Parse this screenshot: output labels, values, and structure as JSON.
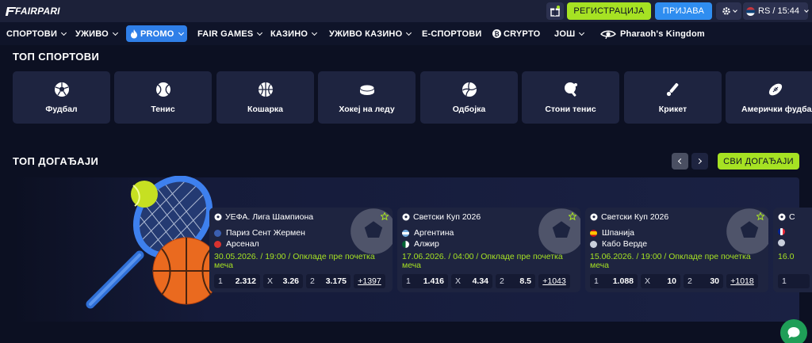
{
  "header": {
    "logo_text": "FAIRPARI",
    "register_label": "РЕГИСТРАЦИЈА",
    "login_label": "ПРИЈАВА",
    "locale_label": "RS / 15:44",
    "colors": {
      "accent_green": "#a6e223",
      "accent_blue": "#2f8df0"
    }
  },
  "nav": {
    "items": [
      {
        "label": "СПОРТОВИ",
        "dropdown": true
      },
      {
        "label": "УЖИВО",
        "dropdown": true
      },
      {
        "label": "PROMO",
        "dropdown": true,
        "active": true,
        "icon": "flame-icon"
      },
      {
        "label": "FAIR GAMES",
        "dropdown": true
      },
      {
        "label": "КАЗИНО",
        "dropdown": true
      },
      {
        "label": "УЖИВО КАЗИНО",
        "dropdown": true
      },
      {
        "label": "Е-СПОРТОВИ",
        "dropdown": false
      },
      {
        "label": "CRYPTO",
        "dropdown": false,
        "icon": "bitcoin-icon"
      },
      {
        "label": "ЈОШ",
        "dropdown": true
      },
      {
        "label": "Pharaoh's Kingdom",
        "dropdown": false,
        "icon": "pharaoh-eye-icon"
      }
    ]
  },
  "top_sports": {
    "title": "ТОП СПОРТОВИ",
    "items": [
      {
        "label": "Фудбал",
        "icon": "soccer-ball-icon"
      },
      {
        "label": "Тенис",
        "icon": "tennis-ball-icon"
      },
      {
        "label": "Кошарка",
        "icon": "basketball-icon"
      },
      {
        "label": "Хокеј на леду",
        "icon": "hockey-puck-icon"
      },
      {
        "label": "Одбојка",
        "icon": "volleyball-icon"
      },
      {
        "label": "Стони тенис",
        "icon": "table-tennis-icon"
      },
      {
        "label": "Крикет",
        "icon": "cricket-icon"
      },
      {
        "label": "Амерички фудбал",
        "icon": "american-football-icon"
      }
    ]
  },
  "top_events": {
    "title": "ТОП ДОГАЂАЈИ",
    "all_label": "СВИ ДОГАЂАЈИ",
    "events": [
      {
        "league": "УЕФА. Лига Шампиона",
        "team1": "Париз Сент Жермен",
        "team2": "Арсенал",
        "date": "30.05.2026. / 19:00 / Опкладе пре почетка меча",
        "odds": [
          {
            "k": "1",
            "v": "2.312"
          },
          {
            "k": "X",
            "v": "3.26"
          },
          {
            "k": "2",
            "v": "3.175"
          }
        ],
        "more": "+1397"
      },
      {
        "league": "Светски Куп 2026",
        "team1": "Аргентина",
        "team2": "Алжир",
        "date": "17.06.2026. / 04:00 / Опкладе пре почетка меча",
        "odds": [
          {
            "k": "1",
            "v": "1.416"
          },
          {
            "k": "X",
            "v": "4.34"
          },
          {
            "k": "2",
            "v": "8.5"
          }
        ],
        "more": "+1043"
      },
      {
        "league": "Светски Куп 2026",
        "team1": "Шпанија",
        "team2": "Кабо Верде",
        "date": "15.06.2026. / 19:00 / Опкладе пре почетка меча",
        "odds": [
          {
            "k": "1",
            "v": "1.088"
          },
          {
            "k": "X",
            "v": "10"
          },
          {
            "k": "2",
            "v": "30"
          }
        ],
        "more": "+1018"
      },
      {
        "league": "С",
        "team1": "",
        "team2": "",
        "date": "16.0",
        "odds": [
          {
            "k": "1",
            "v": ""
          }
        ],
        "more": ""
      }
    ]
  }
}
